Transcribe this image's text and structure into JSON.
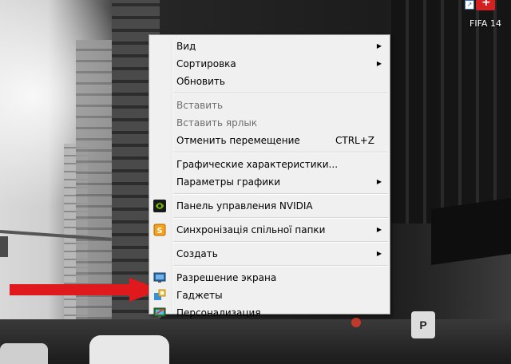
{
  "desktop": {
    "icon_label": "FIFA 14",
    "street_sign_letter": "P"
  },
  "menu": {
    "items": [
      {
        "label": "Вид",
        "submenu": true
      },
      {
        "label": "Сортировка",
        "submenu": true
      },
      {
        "label": "Обновить"
      },
      {
        "label": "Вставить",
        "disabled": true
      },
      {
        "label": "Вставить ярлык",
        "disabled": true
      },
      {
        "label": "Отменить перемещение",
        "shortcut": "CTRL+Z"
      },
      {
        "label": "Графические характеристики..."
      },
      {
        "label": "Параметры графики",
        "submenu": true
      },
      {
        "label": "Панель управления NVIDIA",
        "icon": "nvidia-icon"
      },
      {
        "label": "Синхронізація спільної папки",
        "icon": "sync-folder-icon",
        "submenu": true
      },
      {
        "label": "Создать",
        "submenu": true
      },
      {
        "label": "Разрешение экрана",
        "icon": "display-icon"
      },
      {
        "label": "Гаджеты",
        "icon": "gadgets-icon"
      },
      {
        "label": "Персонализация",
        "icon": "personalization-icon"
      }
    ]
  },
  "colors": {
    "arrow": "#e0191c",
    "menu_background": "#f0f0f0",
    "disabled_text": "#6d6d6d"
  }
}
